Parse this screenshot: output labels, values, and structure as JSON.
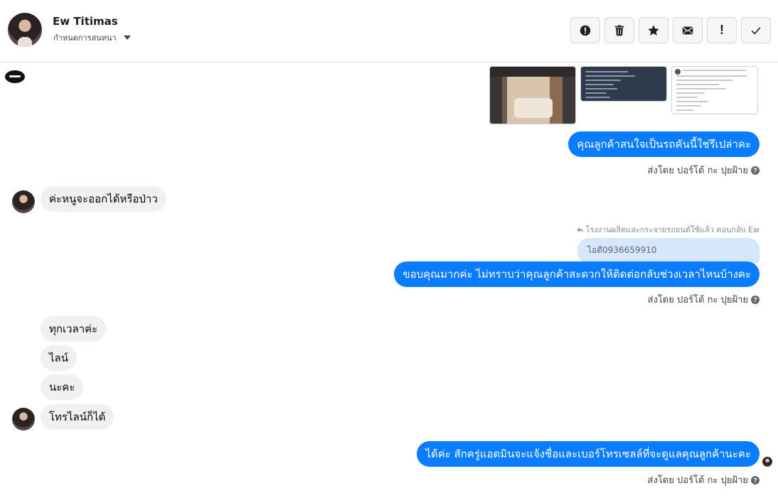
{
  "header": {
    "contact_name": "Ew Titimas",
    "conversation_settings_label": "กำหนดการสนทนา"
  },
  "toolbar": {
    "buttons": [
      {
        "name": "spam",
        "icon": "alert-circle-icon"
      },
      {
        "name": "delete",
        "icon": "trash-icon"
      },
      {
        "name": "star",
        "icon": "star-icon"
      },
      {
        "name": "mark-unread",
        "icon": "envelope-icon"
      },
      {
        "name": "important",
        "icon": "exclamation-icon",
        "glyph": "!"
      },
      {
        "name": "done",
        "icon": "check-icon"
      }
    ]
  },
  "messages": {
    "m1": "คุณลูกค้าสนใจเป็นรถคันนี้ใช่รึเปล่าคะ",
    "m1_sent_by": "ส่งโดย ปอร์โต้ กะ ปุยฝ้าย",
    "m2": "ค่ะหนูจะออกได้หรือป่าว",
    "reply_meta": "โรงงานผลิตและกระจายรถยนต์ใช้แล้ว ตอบกลับ Ew",
    "reply_quote": "ไอดี0936659910",
    "m3": "ขอบคุณมากค่ะ ไม่ทราบว่าคุณลูกค้าสะดวกให้ติดต่อกลับช่วงเวลาไหนบ้างคะ",
    "m3_sent_by": "ส่งโดย ปอร์โต้ กะ ปุยฝ้าย",
    "m4": "ทุกเวลาค่ะ",
    "m5": "ไลน์",
    "m6": "นะคะ",
    "m7": "โทรไลน์ก็ได้",
    "m8": "ได้ค่ะ สักครู่แอดมินจะแจ้งชื่อและเบอร์โทรเซลล์ที่จะดูแลคุณลูกค้านะคะ",
    "m8_sent_by": "ส่งโดย ปอร์โต้ กะ ปุยฝ้าย"
  },
  "help_glyph": "?",
  "colors": {
    "outgoing_bubble": "#0a7cff",
    "incoming_bubble": "#f0f0f0",
    "reply_quote_bg": "#d6e6fc"
  }
}
